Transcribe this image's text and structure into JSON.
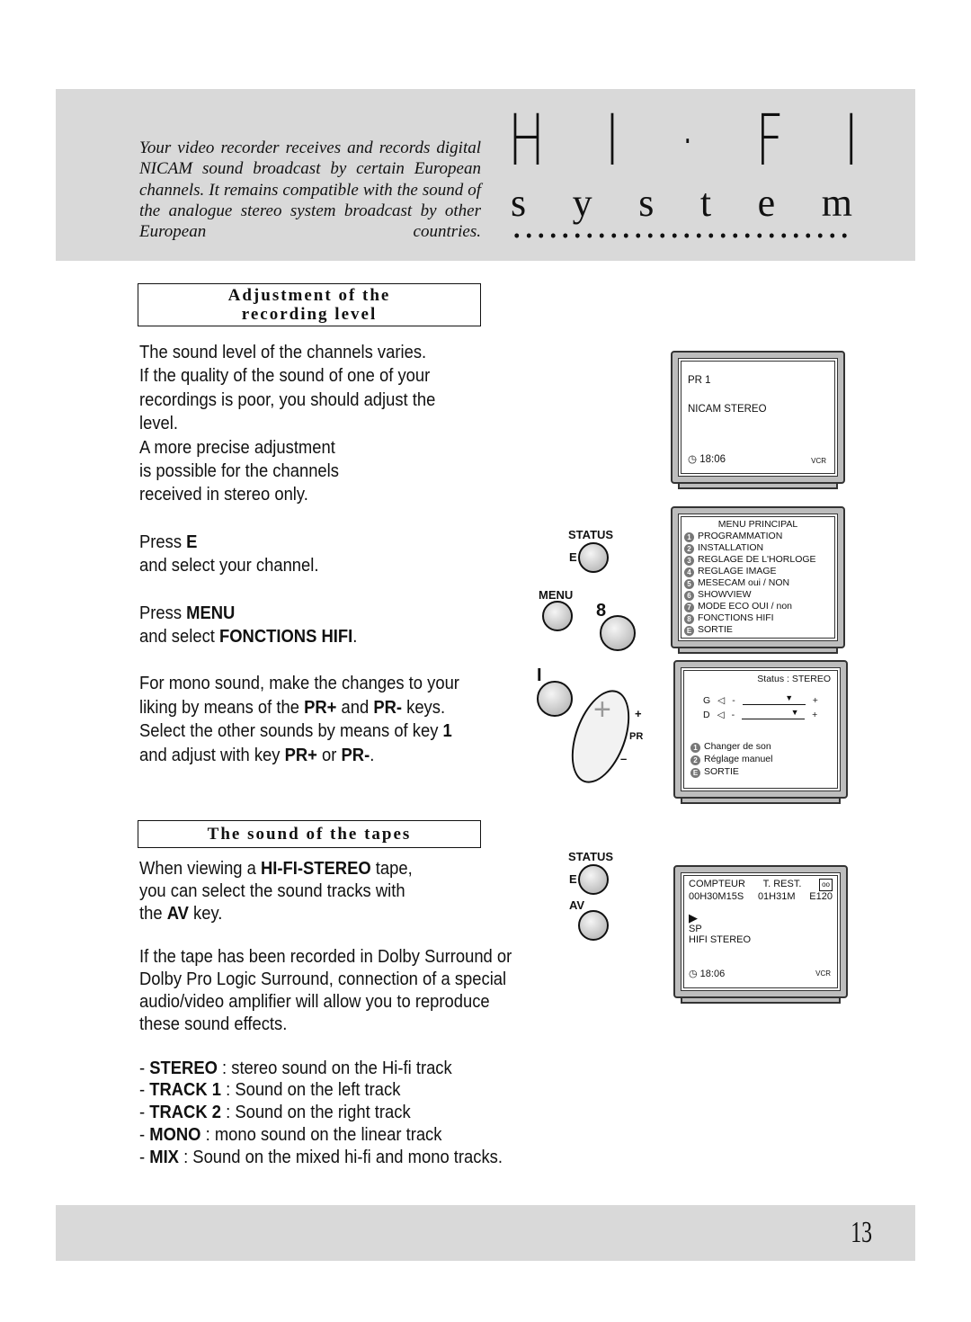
{
  "header": {
    "intro": "Your video recorder receives and records digital NICAM sound broadcast by certain European channels. It remains compatible with the sound of the analogue stereo system broadcast by other European countries.",
    "title_letters": [
      "H",
      "I",
      "·",
      "F",
      "I"
    ],
    "subtitle_letters": [
      "s",
      "y",
      "s",
      "t",
      "e",
      "m"
    ]
  },
  "section1": {
    "heading_line1": "Adjustment of the",
    "heading_line2": "recording level",
    "p1": [
      "The sound level of the channels varies.",
      "If the quality of the sound of one of your",
      "recordings is poor, you should adjust the",
      "level.",
      "A more precise adjustment",
      "is possible for the channels",
      "received in stereo only."
    ],
    "press_e": "Press ",
    "key_e": "E",
    "select_channel": "and select your channel.",
    "press_menu": "Press ",
    "key_menu": "MENU",
    "and_select": "and select ",
    "key_fonctions": "FONCTIONS HIFI",
    ".": ".",
    "mono1": "For mono sound, make the changes to your",
    "mono2a": "liking by means of the ",
    "pr_plus": "PR+",
    "and": " and ",
    "pr_minus": "PR-",
    "keys": " keys.",
    "mono3a": "Select the other sounds by means of key ",
    "key1": "1",
    "mono4a": "and adjust with key ",
    "or": " or ",
    "end": "."
  },
  "section2": {
    "heading": "The sound of the tapes",
    "p1a": "When viewing a ",
    "hifi_stereo": "HI-FI-STEREO",
    "p1b": " tape,",
    "p1c": "you can select the sound tracks with",
    "p1d": "the ",
    "av": "AV",
    "p1e": " key.",
    "p2": [
      "If the tape has been recorded in Dolby Surround or",
      "Dolby Pro Logic Surround, connection of a special",
      "audio/video amplifier will allow you to reproduce",
      "these sound effects."
    ],
    "list": [
      {
        "key": "STEREO",
        "text": " : stereo sound on the Hi-fi track"
      },
      {
        "key": "TRACK 1",
        "text": " : Sound on the left track"
      },
      {
        "key": "TRACK 2",
        "text": " : Sound on the right track"
      },
      {
        "key": "MONO",
        "text": " : mono sound on the linear track"
      },
      {
        "key": "MIX",
        "text": " : Sound on the mixed hi-fi and mono tracks."
      }
    ]
  },
  "remote": {
    "status": "STATUS",
    "e": "E",
    "menu": "MENU",
    "eight": "8",
    "one": "I",
    "plus": "+",
    "pr": "PR",
    "minus": "–",
    "status2": "STATUS",
    "e2": "E",
    "av": "AV"
  },
  "screen1": {
    "pr": "PR 1",
    "mode": "NICAM STEREO",
    "time": "18:06",
    "source": "VCR"
  },
  "screen2": {
    "title": "MENU PRINCIPAL",
    "items": [
      {
        "n": "1",
        "label": "PROGRAMMATION"
      },
      {
        "n": "2",
        "label": "INSTALLATION"
      },
      {
        "n": "3",
        "label": "REGLAGE DE L'HORLOGE"
      },
      {
        "n": "4",
        "label": "REGLAGE IMAGE"
      },
      {
        "n": "5",
        "label": "MESECAM oui / NON"
      },
      {
        "n": "6",
        "label": "SHOWVIEW"
      },
      {
        "n": "7",
        "label": "MODE ECO OUI / non"
      },
      {
        "n": "8",
        "label": "FONCTIONS HIFI"
      },
      {
        "n": "E",
        "label": "SORTIE"
      }
    ]
  },
  "screen3": {
    "status": "Status : STEREO",
    "g": "G",
    "d": "D",
    "minus": "-",
    "plus": "+",
    "g_level_pct": 75,
    "d_level_pct": 85,
    "items": [
      {
        "n": "1",
        "label": "Changer de son"
      },
      {
        "n": "2",
        "label": "Réglage manuel"
      },
      {
        "n": "E",
        "label": "SORTIE"
      }
    ]
  },
  "screen4": {
    "compteur": "COMPTEUR",
    "trest": "T. REST.",
    "counter": "00H30M15S",
    "remaining": "01H31M",
    "tape": "E120",
    "speed": "SP",
    "mode": "HIFI STEREO",
    "time": "18:06",
    "source": "VCR"
  },
  "footer": {
    "page_number": "13"
  }
}
